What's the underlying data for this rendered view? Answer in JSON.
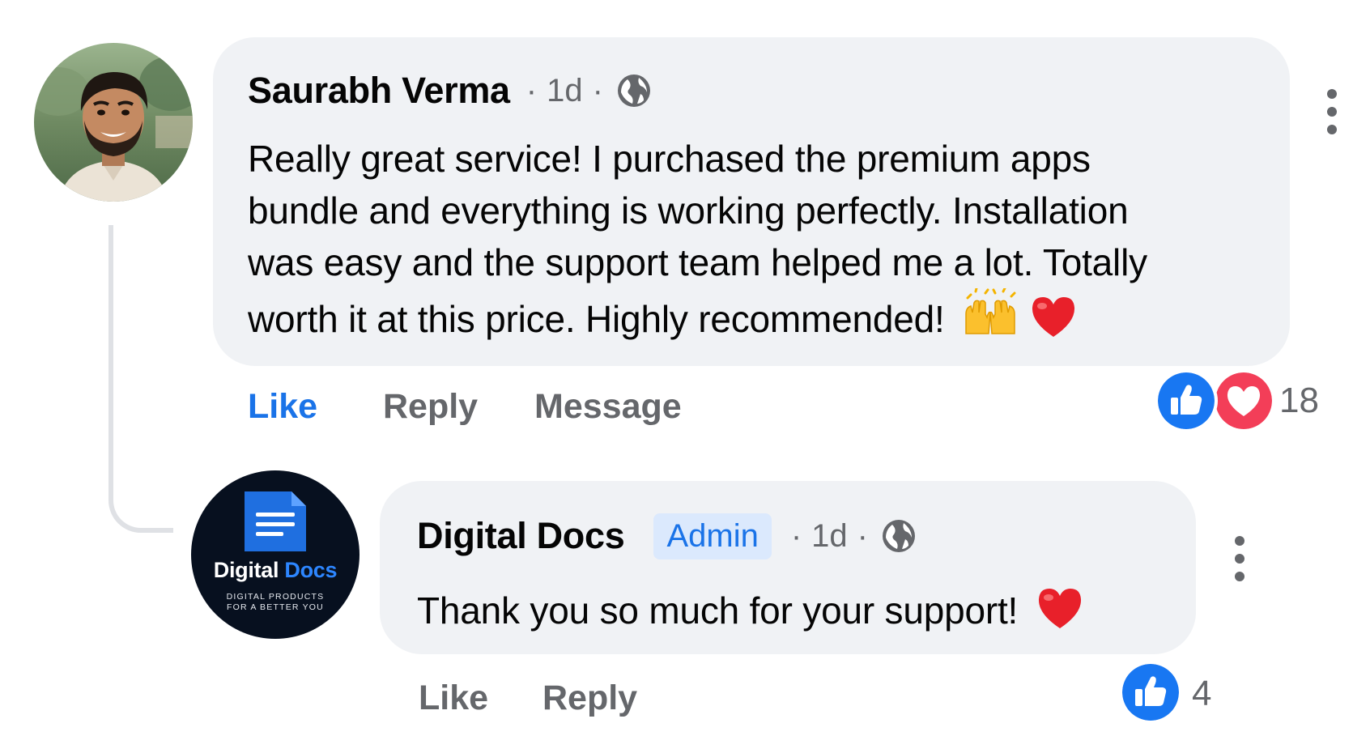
{
  "comment": {
    "author": "Saurabh Verma",
    "time": "1d",
    "separator": "·",
    "text_lines": [
      "Really great service! I purchased the premium apps",
      "bundle and everything is working perfectly. Installation",
      "was easy and the support team helped me a lot. Totally",
      "worth it at this price. Highly recommended!"
    ],
    "emojis": [
      "raising-hands",
      "red-heart"
    ],
    "actions": {
      "like": "Like",
      "reply": "Reply",
      "message": "Message"
    },
    "reactions": {
      "types": [
        "like",
        "love"
      ],
      "count": "18"
    }
  },
  "reply": {
    "author": "Digital Docs",
    "badge": "Admin",
    "time": "1d",
    "separator": "·",
    "text": "Thank you so much for your support!",
    "emojis": [
      "red-heart"
    ],
    "actions": {
      "like": "Like",
      "reply": "Reply"
    },
    "reactions": {
      "types": [
        "like"
      ],
      "count": "4"
    }
  },
  "brand_logo": {
    "name_part1": "Digital",
    "name_part2": "Docs",
    "tagline_line1": "DIGITAL PRODUCTS",
    "tagline_line2": "FOR A BETTER YOU"
  },
  "colors": {
    "bubble_bg": "#f0f2f5",
    "accent_blue": "#1a73e8",
    "like_blue": "#1877f2",
    "love_red": "#f33e58",
    "muted_text": "#65676b",
    "admin_badge_bg": "#dbe9fd"
  }
}
